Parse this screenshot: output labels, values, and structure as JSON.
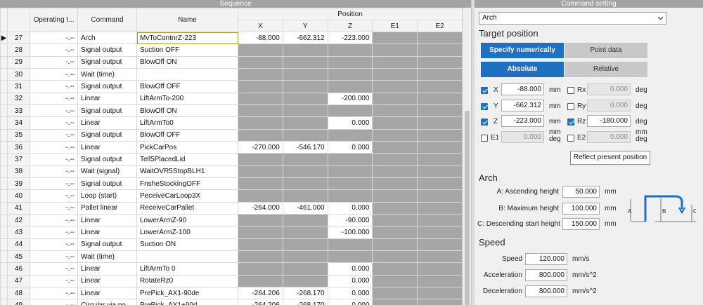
{
  "sequence": {
    "title": "Sequence",
    "headers": {
      "operating_time": "Operating t...",
      "command": "Command",
      "name": "Name",
      "position": "Position",
      "x": "X",
      "y": "Y",
      "z": "Z",
      "e1": "E1",
      "e2": "E2"
    },
    "current_row_marker": "▶",
    "rows": [
      {
        "num": "27",
        "op": "-.--",
        "cmd": "Arch",
        "name": "MvToContnrZ-223",
        "x": "-88.000",
        "y": "-662.312",
        "z": "-223.000",
        "e1": "",
        "e2": "",
        "fill": [
          0,
          0,
          0,
          1,
          1
        ],
        "selected": true
      },
      {
        "num": "28",
        "op": "-.--",
        "cmd": "Signal output",
        "name": "Suction OFF",
        "x": "",
        "y": "",
        "z": "",
        "e1": "",
        "e2": "",
        "fill": [
          1,
          1,
          1,
          1,
          1
        ]
      },
      {
        "num": "29",
        "op": "-.--",
        "cmd": "Signal output",
        "name": "BlowOff ON",
        "x": "",
        "y": "",
        "z": "",
        "e1": "",
        "e2": "",
        "fill": [
          1,
          1,
          1,
          1,
          1
        ]
      },
      {
        "num": "30",
        "op": "-.--",
        "cmd": "Wait (time)",
        "name": "",
        "x": "",
        "y": "",
        "z": "",
        "e1": "",
        "e2": "",
        "fill": [
          1,
          1,
          1,
          1,
          1
        ]
      },
      {
        "num": "31",
        "op": "-.--",
        "cmd": "Signal output",
        "name": "BlowOff OFF",
        "x": "",
        "y": "",
        "z": "",
        "e1": "",
        "e2": "",
        "fill": [
          1,
          1,
          1,
          1,
          1
        ]
      },
      {
        "num": "32",
        "op": "-.--",
        "cmd": "Linear",
        "name": "LiftArmTo-200",
        "x": "",
        "y": "",
        "z": "-200.000",
        "e1": "",
        "e2": "",
        "fill": [
          1,
          1,
          0,
          1,
          1
        ]
      },
      {
        "num": "33",
        "op": "-.--",
        "cmd": "Signal output",
        "name": "BlowOff ON",
        "x": "",
        "y": "",
        "z": "",
        "e1": "",
        "e2": "",
        "fill": [
          1,
          1,
          1,
          1,
          1
        ]
      },
      {
        "num": "34",
        "op": "-.--",
        "cmd": "Linear",
        "name": "LiftArmTo0",
        "x": "",
        "y": "",
        "z": "0.000",
        "e1": "",
        "e2": "",
        "fill": [
          1,
          1,
          0,
          1,
          1
        ]
      },
      {
        "num": "35",
        "op": "-.--",
        "cmd": "Signal output",
        "name": "BlowOff OFF",
        "x": "",
        "y": "",
        "z": "",
        "e1": "",
        "e2": "",
        "fill": [
          1,
          1,
          1,
          1,
          1
        ]
      },
      {
        "num": "36",
        "op": "-.--",
        "cmd": "Linear",
        "name": "PickCarPos",
        "x": "-270.000",
        "y": "-546.170",
        "z": "0.000",
        "e1": "",
        "e2": "",
        "fill": [
          0,
          0,
          0,
          1,
          1
        ]
      },
      {
        "num": "37",
        "op": "-.--",
        "cmd": "Signal output",
        "name": "Tell5PlacedLid",
        "x": "",
        "y": "",
        "z": "",
        "e1": "",
        "e2": "",
        "fill": [
          1,
          1,
          1,
          1,
          1
        ]
      },
      {
        "num": "38",
        "op": "-.--",
        "cmd": "Wait (signal)",
        "name": "WaitOVR5StopBLH1",
        "x": "",
        "y": "",
        "z": "",
        "e1": "",
        "e2": "",
        "fill": [
          1,
          1,
          1,
          1,
          1
        ]
      },
      {
        "num": "39",
        "op": "-.--",
        "cmd": "Signal output",
        "name": "FnsheStockingOFF",
        "x": "",
        "y": "",
        "z": "",
        "e1": "",
        "e2": "",
        "fill": [
          1,
          1,
          1,
          1,
          1
        ]
      },
      {
        "num": "40",
        "op": "-.--",
        "cmd": "Loop (start)",
        "name": "PeceiveCarLoop3X",
        "x": "",
        "y": "",
        "z": "",
        "e1": "",
        "e2": "",
        "fill": [
          1,
          1,
          1,
          1,
          1
        ]
      },
      {
        "num": "41",
        "op": "-.--",
        "cmd": "Pallet linear",
        "name": "ReceiveCarPallet",
        "x": "-264.000",
        "y": "-461.000",
        "z": "0.000",
        "e1": "",
        "e2": "",
        "fill": [
          0,
          0,
          0,
          1,
          1
        ]
      },
      {
        "num": "42",
        "op": "-.--",
        "cmd": "Linear",
        "name": "LowerArmZ-90",
        "x": "",
        "y": "",
        "z": "-90.000",
        "e1": "",
        "e2": "",
        "fill": [
          1,
          1,
          0,
          1,
          1
        ]
      },
      {
        "num": "43",
        "op": "-.--",
        "cmd": "Linear",
        "name": "LowerArmZ-100",
        "x": "",
        "y": "",
        "z": "-100.000",
        "e1": "",
        "e2": "",
        "fill": [
          1,
          1,
          0,
          1,
          1
        ]
      },
      {
        "num": "44",
        "op": "-.--",
        "cmd": "Signal output",
        "name": "Suction ON",
        "x": "",
        "y": "",
        "z": "",
        "e1": "",
        "e2": "",
        "fill": [
          1,
          1,
          1,
          1,
          1
        ]
      },
      {
        "num": "45",
        "op": "-.--",
        "cmd": "Wait (time)",
        "name": "",
        "x": "",
        "y": "",
        "z": "",
        "e1": "",
        "e2": "",
        "fill": [
          1,
          1,
          1,
          1,
          1
        ]
      },
      {
        "num": "46",
        "op": "-.--",
        "cmd": "Linear",
        "name": "LiftArmTo 0",
        "x": "",
        "y": "",
        "z": "0.000",
        "e1": "",
        "e2": "",
        "fill": [
          1,
          1,
          0,
          1,
          1
        ]
      },
      {
        "num": "47",
        "op": "-.--",
        "cmd": "Linear",
        "name": "RotateRz0",
        "x": "",
        "y": "",
        "z": "0.000",
        "e1": "",
        "e2": "",
        "fill": [
          1,
          1,
          0,
          1,
          1
        ]
      },
      {
        "num": "48",
        "op": "-.--",
        "cmd": "Linear",
        "name": "PrePick_AX1-90de",
        "x": "-264.206",
        "y": "-268.170",
        "z": "0.000",
        "e1": "",
        "e2": "",
        "fill": [
          0,
          0,
          0,
          1,
          1
        ]
      },
      {
        "num": "49",
        "op": "-.--",
        "cmd": "Circular via po...",
        "name": "PrePick_AX1+90d",
        "x": "-264.206",
        "y": "-268.170",
        "z": "0.000",
        "e1": "",
        "e2": "",
        "fill": [
          0,
          0,
          0,
          1,
          1
        ]
      }
    ]
  },
  "command_setting": {
    "title": "Command setting",
    "command_type": "Arch",
    "target_position": {
      "heading": "Target position",
      "mode_tabs": [
        {
          "label": "Specify numerically",
          "active": true
        },
        {
          "label": "Point data",
          "active": false
        }
      ],
      "coord_tabs": [
        {
          "label": "Absolute",
          "active": true
        },
        {
          "label": "Relative",
          "active": false
        }
      ],
      "axes_left": [
        {
          "label": "X",
          "checked": true,
          "value": "-88.000",
          "unit": "mm",
          "enabled": true
        },
        {
          "label": "Y",
          "checked": true,
          "value": "-662.312",
          "unit": "mm",
          "enabled": true
        },
        {
          "label": "Z",
          "checked": true,
          "value": "-223.000",
          "unit": "mm",
          "enabled": true
        },
        {
          "label": "E1",
          "checked": false,
          "value": "0.000",
          "unit": "mm deg",
          "enabled": false
        }
      ],
      "axes_right": [
        {
          "label": "Rx",
          "checked": false,
          "value": "0.000",
          "unit": "deg",
          "enabled": false
        },
        {
          "label": "Ry",
          "checked": false,
          "value": "0.000",
          "unit": "deg",
          "enabled": false
        },
        {
          "label": "Rz",
          "checked": true,
          "value": "-180.000",
          "unit": "deg",
          "enabled": true
        },
        {
          "label": "E2",
          "checked": false,
          "value": "0.000",
          "unit": "mm deg",
          "enabled": false
        }
      ],
      "reflect_button": "Reflect present position"
    },
    "arch": {
      "heading": "Arch",
      "fields": [
        {
          "label": "A:  Ascending height",
          "value": "50.000",
          "unit": "mm"
        },
        {
          "label": "B:  Maximum height",
          "value": "100.000",
          "unit": "mm"
        },
        {
          "label": "C:  Descending start height",
          "value": "150.000",
          "unit": "mm"
        }
      ],
      "diagram_labels": {
        "a": "A",
        "b": "B",
        "c": "C"
      }
    },
    "speed": {
      "heading": "Speed",
      "fields": [
        {
          "label": "Speed",
          "value": "120.000",
          "unit": "mm/s"
        },
        {
          "label": "Acceleration",
          "value": "800.000",
          "unit": "mm/s^2"
        },
        {
          "label": "Deceleration",
          "value": "800.000",
          "unit": "mm/s^2"
        }
      ]
    }
  },
  "colors": {
    "accent": "#1f70c1",
    "disabled_cell": "#a6a6a6",
    "title_bar": "#a3a3a3"
  }
}
